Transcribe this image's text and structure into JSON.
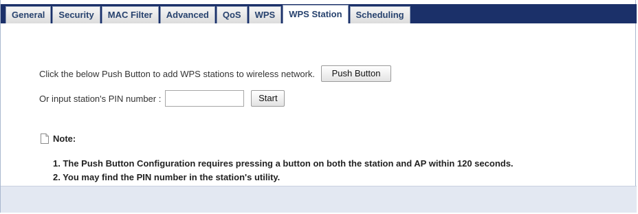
{
  "tabs": [
    {
      "label": "General",
      "active": false
    },
    {
      "label": "Security",
      "active": false
    },
    {
      "label": "MAC Filter",
      "active": false
    },
    {
      "label": "Advanced",
      "active": false
    },
    {
      "label": "QoS",
      "active": false
    },
    {
      "label": "WPS",
      "active": false
    },
    {
      "label": "WPS Station",
      "active": true
    },
    {
      "label": "Scheduling",
      "active": false
    }
  ],
  "push": {
    "description": "Click the below Push Button to add WPS stations to wireless network.",
    "button_label": "Push Button"
  },
  "pin": {
    "label": "Or input station's PIN number :",
    "value": "",
    "start_label": "Start"
  },
  "note": {
    "heading": "Note:",
    "items": [
      "1. The Push Button Configuration requires pressing a button on both the station and AP within 120 seconds.",
      "2. You may find the PIN number in the station's utility."
    ]
  },
  "icons": {
    "note": "note-page-icon"
  },
  "colors": {
    "tabbar": "#1b3069",
    "tab_text": "#27426e",
    "footer": "#e3e8f2"
  }
}
